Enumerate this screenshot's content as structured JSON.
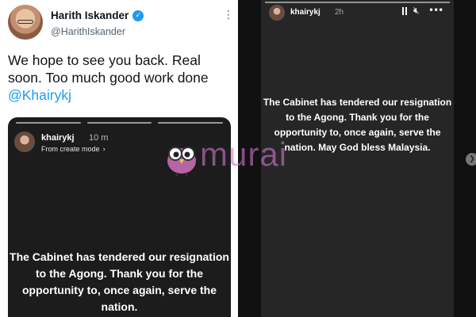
{
  "tweet": {
    "author_name": "Harith Iskander",
    "author_handle": "@HarithIskander",
    "text": "We hope to see you back. Real soon. Too much good work done",
    "mention": "@Khairykj",
    "embedded_story": {
      "username": "khairykj",
      "time": "10 m",
      "mode": "From create mode",
      "text": "The Cabinet has tendered our resignation to the Agong. Thank you for the opportunity to, once again, serve the nation."
    }
  },
  "story": {
    "username": "khairykj",
    "time": "2h",
    "text": "The Cabinet has tendered our resignation to the Agong. Thank you for the opportunity to, once again, serve the nation. May God bless Malaysia."
  },
  "watermark": {
    "brand": "murai"
  },
  "icons": {
    "verified": "verified-badge-icon",
    "more": "more-vertical-icon",
    "pause": "pause-icon",
    "mute": "volume-mute-icon",
    "story_more": "more-horizontal-icon",
    "next": "chevron-right-icon"
  },
  "colors": {
    "twitter_blue": "#1d9bf0",
    "story_bg": "#262626",
    "watermark": "#cd78cd"
  }
}
